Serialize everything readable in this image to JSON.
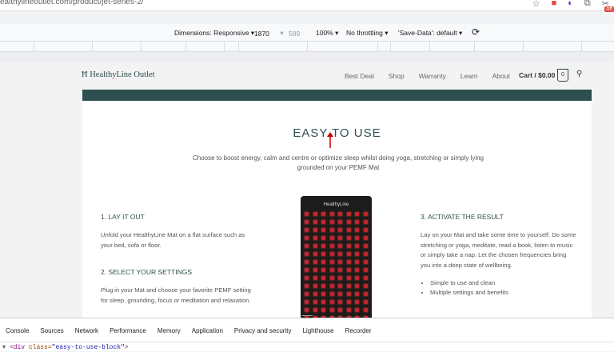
{
  "browser": {
    "url": "ealthylineoutlet.com/product/jet-series-2/",
    "icons": [
      "star-icon",
      "extension-icon",
      "extension-icon",
      "puzzle-icon",
      "scissors-icon"
    ],
    "badge": "off"
  },
  "device_toolbar": {
    "dimensions_label": "Dimensions: Responsive ▾",
    "width": "1870",
    "times": "×",
    "height": "589",
    "zoom": "100% ▾",
    "throttle": "No throttling ▾",
    "save_data": "'Save-Data': default ▾"
  },
  "site": {
    "logo": "HealthyLine Outlet",
    "nav": [
      "Best Deal",
      "Shop",
      "Warranty",
      "Learn",
      "About"
    ],
    "cart": "Cart / $0.00",
    "cart_count": "0",
    "heading": "EASY TO USE",
    "intro": "Choose to boost energy, calm and centre or optimize sleep whilst doing yoga, stretching or simply lying grounded on your PEMF Mat",
    "step1_title": "1. LAY IT OUT",
    "step1_text": "Unfold your HealthyLine Mat on a flat surface such as your bed, sofa or floor.",
    "step2_title": "2. SELECT YOUR SETTINGS",
    "step2_text": "Plug in your Mat and choose your favorite PEMF setting for sleep, grounding, focus or meditation and relaxation.",
    "step3_title": "3. ACTIVATE THE RESULT",
    "step3_text": "Lay on your Mat and take some time to yourself. Do some stretching or yoga, meditate, read a book, listen to music or simply take a nap. Let the chosen frequencies bring you into a deep state of wellbeing.",
    "bullets": [
      "Simple to use and clean",
      "Multiple settings and benefits"
    ],
    "mat_logo": "HealthyLine"
  },
  "devtools": {
    "tabs": [
      "Console",
      "Sources",
      "Network",
      "Performance",
      "Memory",
      "Application",
      "Privacy and security",
      "Lighthouse",
      "Recorder"
    ],
    "code_tag": "<div ",
    "code_attr": "class=",
    "code_val": "\"easy-to-use-block\"",
    "code_end": ">"
  }
}
